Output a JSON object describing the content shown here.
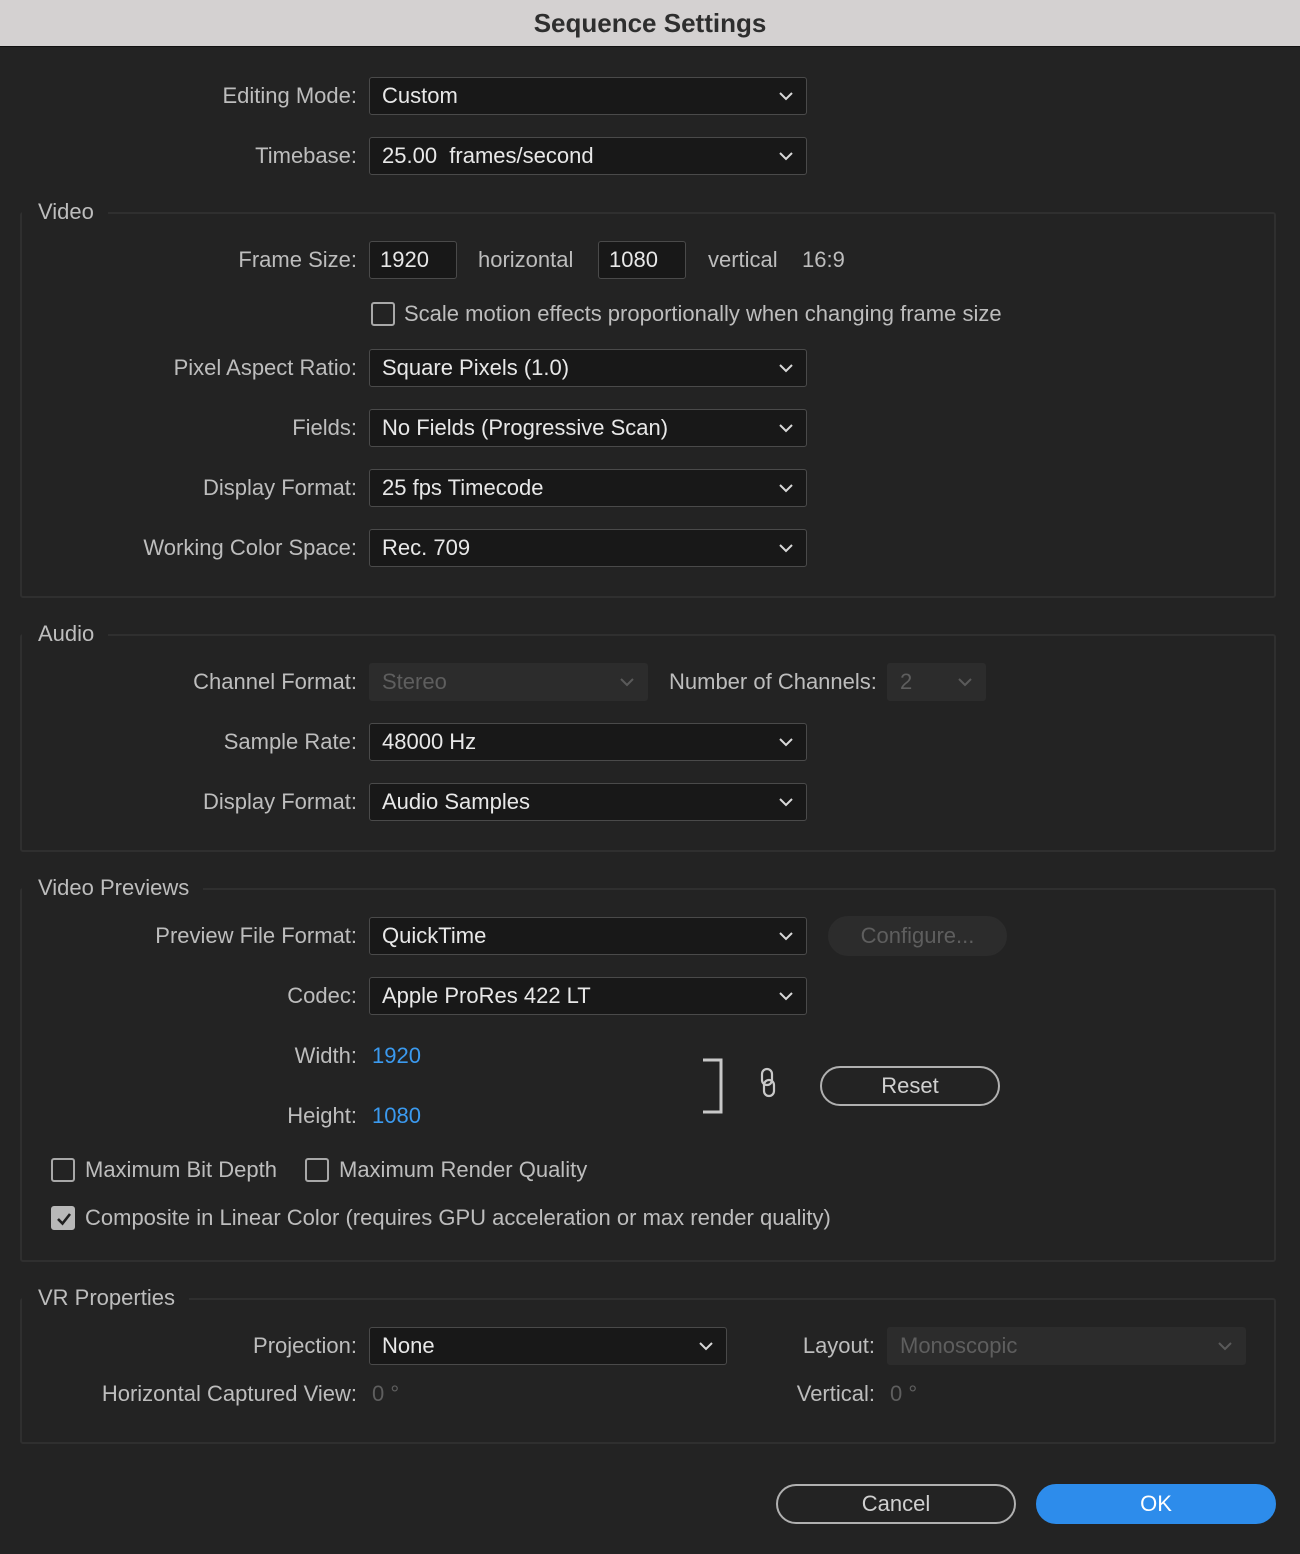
{
  "window": {
    "title": "Sequence Settings"
  },
  "general": {
    "editing_mode_label": "Editing Mode:",
    "editing_mode_value": "Custom",
    "timebase_label": "Timebase:",
    "timebase_value": "25.00  frames/second"
  },
  "video": {
    "title": "Video",
    "frame_size_label": "Frame Size:",
    "frame_width": "1920",
    "horizontal_label": "horizontal",
    "frame_height": "1080",
    "vertical_label": "vertical",
    "aspect": "16:9",
    "scale_motion_label": "Scale motion effects proportionally when changing frame size",
    "scale_motion_checked": false,
    "pixel_aspect_label": "Pixel Aspect Ratio:",
    "pixel_aspect_value": "Square Pixels (1.0)",
    "fields_label": "Fields:",
    "fields_value": "No Fields (Progressive Scan)",
    "display_format_label": "Display Format:",
    "display_format_value": "25 fps Timecode",
    "color_space_label": "Working Color Space:",
    "color_space_value": "Rec. 709"
  },
  "audio": {
    "title": "Audio",
    "channel_format_label": "Channel Format:",
    "channel_format_value": "Stereo",
    "num_channels_label": "Number of Channels:",
    "num_channels_value": "2",
    "sample_rate_label": "Sample Rate:",
    "sample_rate_value": "48000 Hz",
    "display_format_label": "Display Format:",
    "display_format_value": "Audio Samples"
  },
  "previews": {
    "title": "Video Previews",
    "file_format_label": "Preview File Format:",
    "file_format_value": "QuickTime",
    "configure_label": "Configure...",
    "codec_label": "Codec:",
    "codec_value": "Apple ProRes 422 LT",
    "width_label": "Width:",
    "width_value": "1920",
    "height_label": "Height:",
    "height_value": "1080",
    "reset_label": "Reset",
    "max_bit_depth_label": "Maximum Bit Depth",
    "max_bit_depth_checked": false,
    "max_render_quality_label": "Maximum Render Quality",
    "max_render_quality_checked": false,
    "linear_color_label": "Composite in Linear Color (requires GPU acceleration or max render quality)",
    "linear_color_checked": true
  },
  "vr": {
    "title": "VR Properties",
    "projection_label": "Projection:",
    "projection_value": "None",
    "layout_label": "Layout:",
    "layout_value": "Monoscopic",
    "h_view_label": "Horizontal Captured View:",
    "h_view_value": "0 °",
    "vertical_label": "Vertical:",
    "vertical_value": "0 °"
  },
  "footer": {
    "cancel_label": "Cancel",
    "ok_label": "OK"
  },
  "colors": {
    "background": "#232323",
    "accent": "#2d8ceb",
    "value_blue": "#3b9aef",
    "titlebar": "#d4d1d1"
  }
}
